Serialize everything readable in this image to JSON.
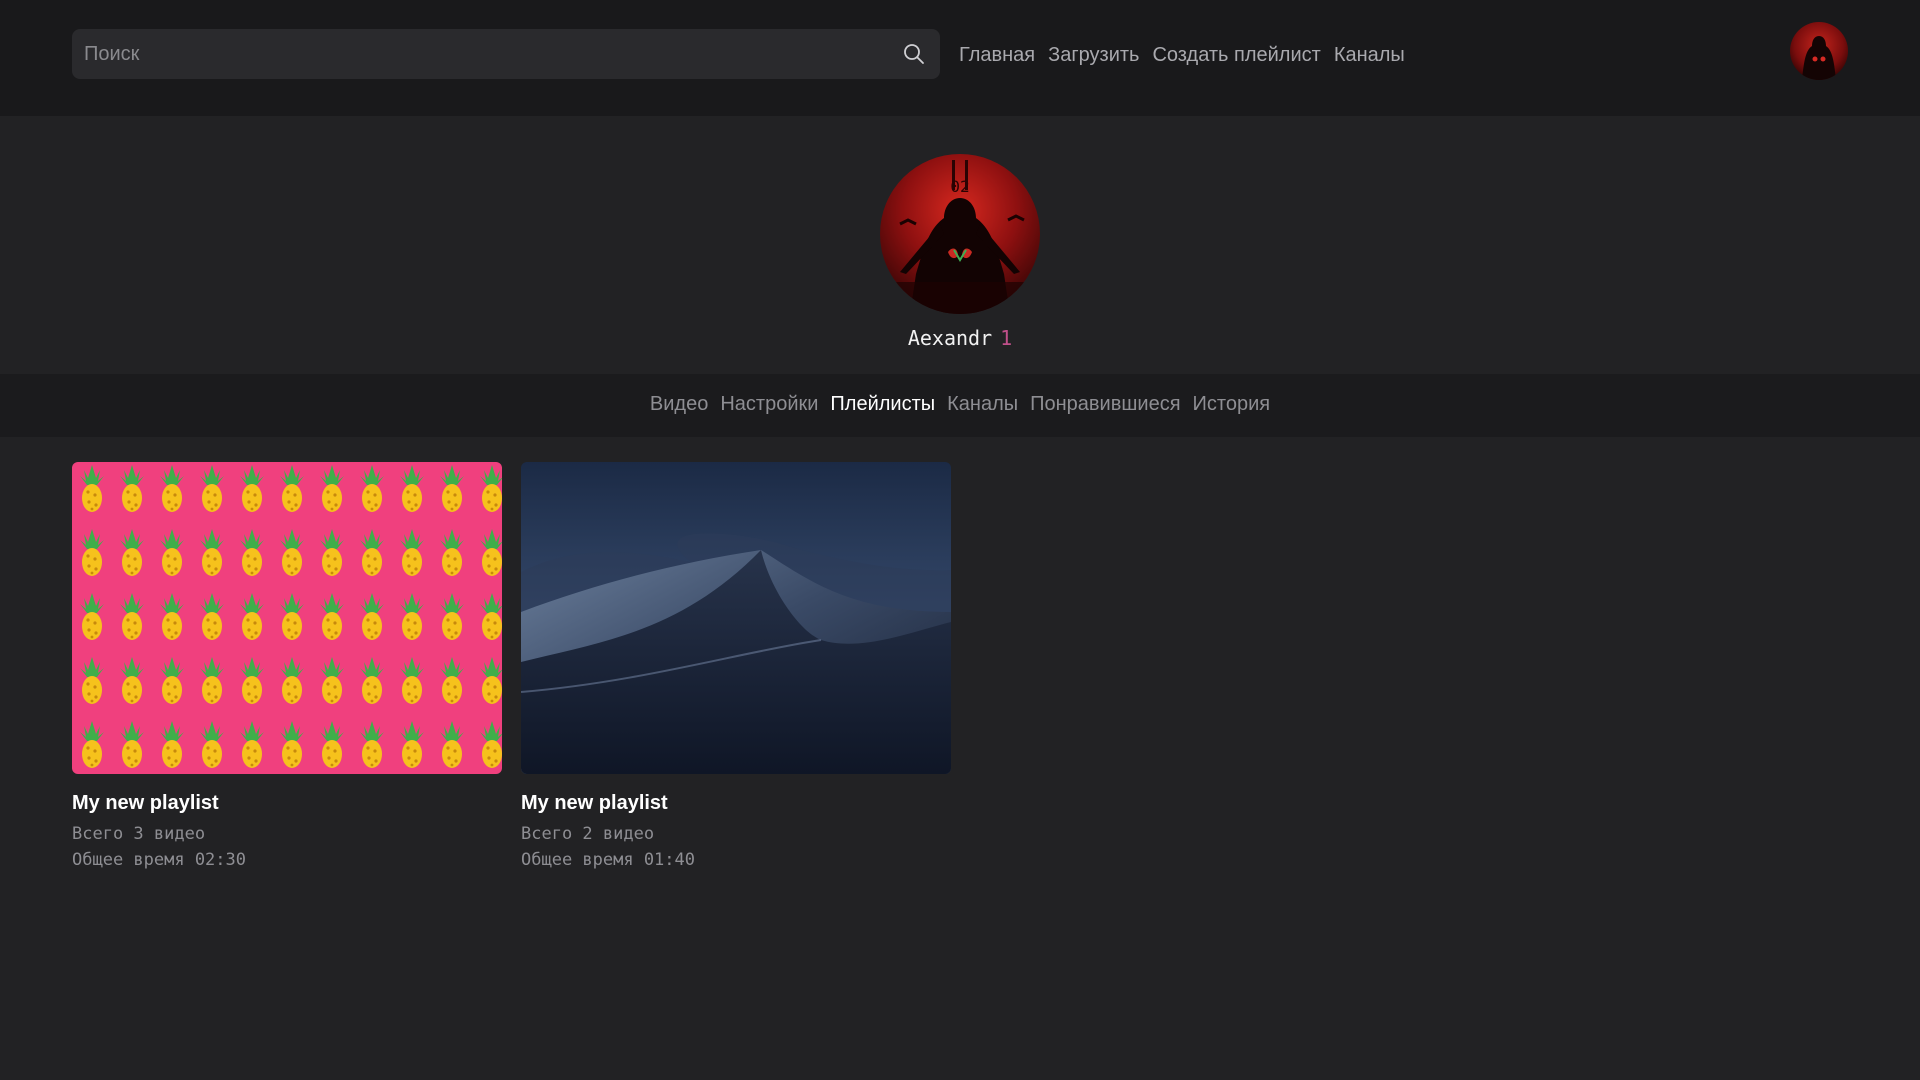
{
  "header": {
    "search_placeholder": "Поиск",
    "search_icon": "search-icon",
    "nav": [
      {
        "label": "Главная"
      },
      {
        "label": "Загрузить"
      },
      {
        "label": "Создать плейлист"
      },
      {
        "label": "Каналы"
      }
    ]
  },
  "profile": {
    "name": "Aexandr",
    "count": "1"
  },
  "tabs": [
    {
      "label": "Видео",
      "active": false
    },
    {
      "label": "Настройки",
      "active": false
    },
    {
      "label": "Плейлисты",
      "active": true
    },
    {
      "label": "Каналы",
      "active": false
    },
    {
      "label": "Понравившиеся",
      "active": false
    },
    {
      "label": "История",
      "active": false
    }
  ],
  "playlists": [
    {
      "title": "My new playlist",
      "videos": "Всего 3 видео",
      "duration": "Общее время 02:30",
      "thumbnail": "pineapple-pattern"
    },
    {
      "title": "My new playlist",
      "videos": "Всего 2 видео",
      "duration": "Общее время 01:40",
      "thumbnail": "night-desert-dunes"
    }
  ],
  "colors": {
    "background": "#222224",
    "header": "#19191b",
    "tabs_bar": "#1b1b1d",
    "accent_count": "#c0508a",
    "pineapple_bg": "#f0407e"
  }
}
